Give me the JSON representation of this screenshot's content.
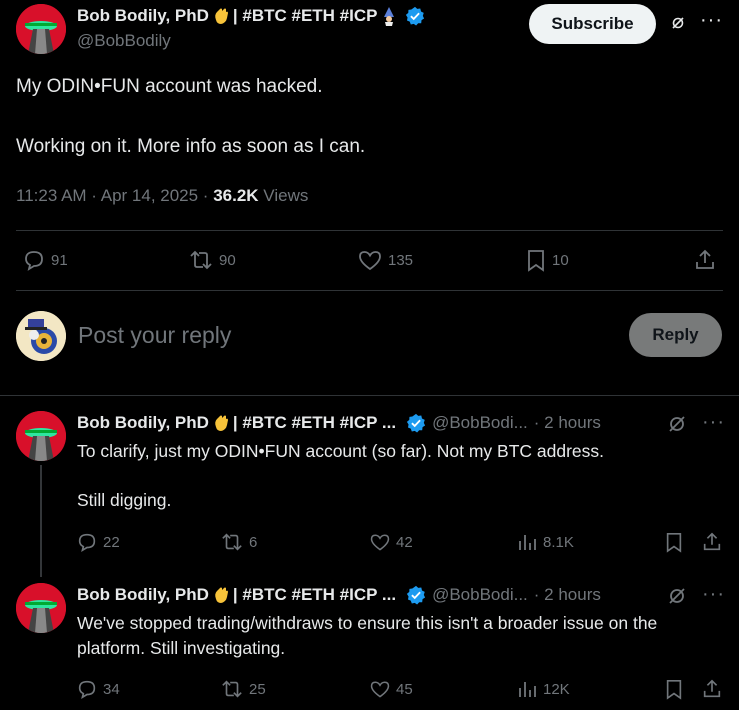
{
  "main_post": {
    "author_name": "Bob Bodily, PhD",
    "author_tags": "| #BTC #ETH #ICP",
    "handle": "@BobBodily",
    "subscribe_label": "Subscribe",
    "text_line1": "My ODIN•FUN account was hacked.",
    "text_line2": "Working on it. More info as soon as I can.",
    "timestamp": "11:23 AM · Apr 14, 2025 · ",
    "views_count": "36.2K",
    "views_label": " Views",
    "replies": "91",
    "reposts": "90",
    "likes": "135",
    "bookmarks": "10"
  },
  "composer": {
    "placeholder": "Post your reply",
    "reply_label": "Reply"
  },
  "replies": [
    {
      "author_name": "Bob Bodily, PhD",
      "author_tags": "| #BTC #ETH #ICP ...",
      "handle": "@BobBodi...",
      "time": "· 2 hours",
      "text_line1": "To clarify, just my ODIN•FUN account (so far). Not my BTC address.",
      "text_line2": "Still digging.",
      "replies": "22",
      "reposts": "6",
      "likes": "42",
      "views": "8.1K"
    },
    {
      "author_name": "Bob Bodily, PhD",
      "author_tags": "| #BTC #ETH #ICP ...",
      "handle": "@BobBodi...",
      "time": "· 2 hours",
      "text_line1": "We've stopped trading/withdraws to ensure this isn't a broader issue on the",
      "text_line2": "platform. Still investigating.",
      "replies": "34",
      "reposts": "25",
      "likes": "45",
      "views": "12K"
    }
  ],
  "colors": {
    "background": "#000000",
    "text": "#e7e9ea",
    "muted": "#71767b",
    "verified": "#1d9bf0",
    "divider": "#2f3336"
  }
}
